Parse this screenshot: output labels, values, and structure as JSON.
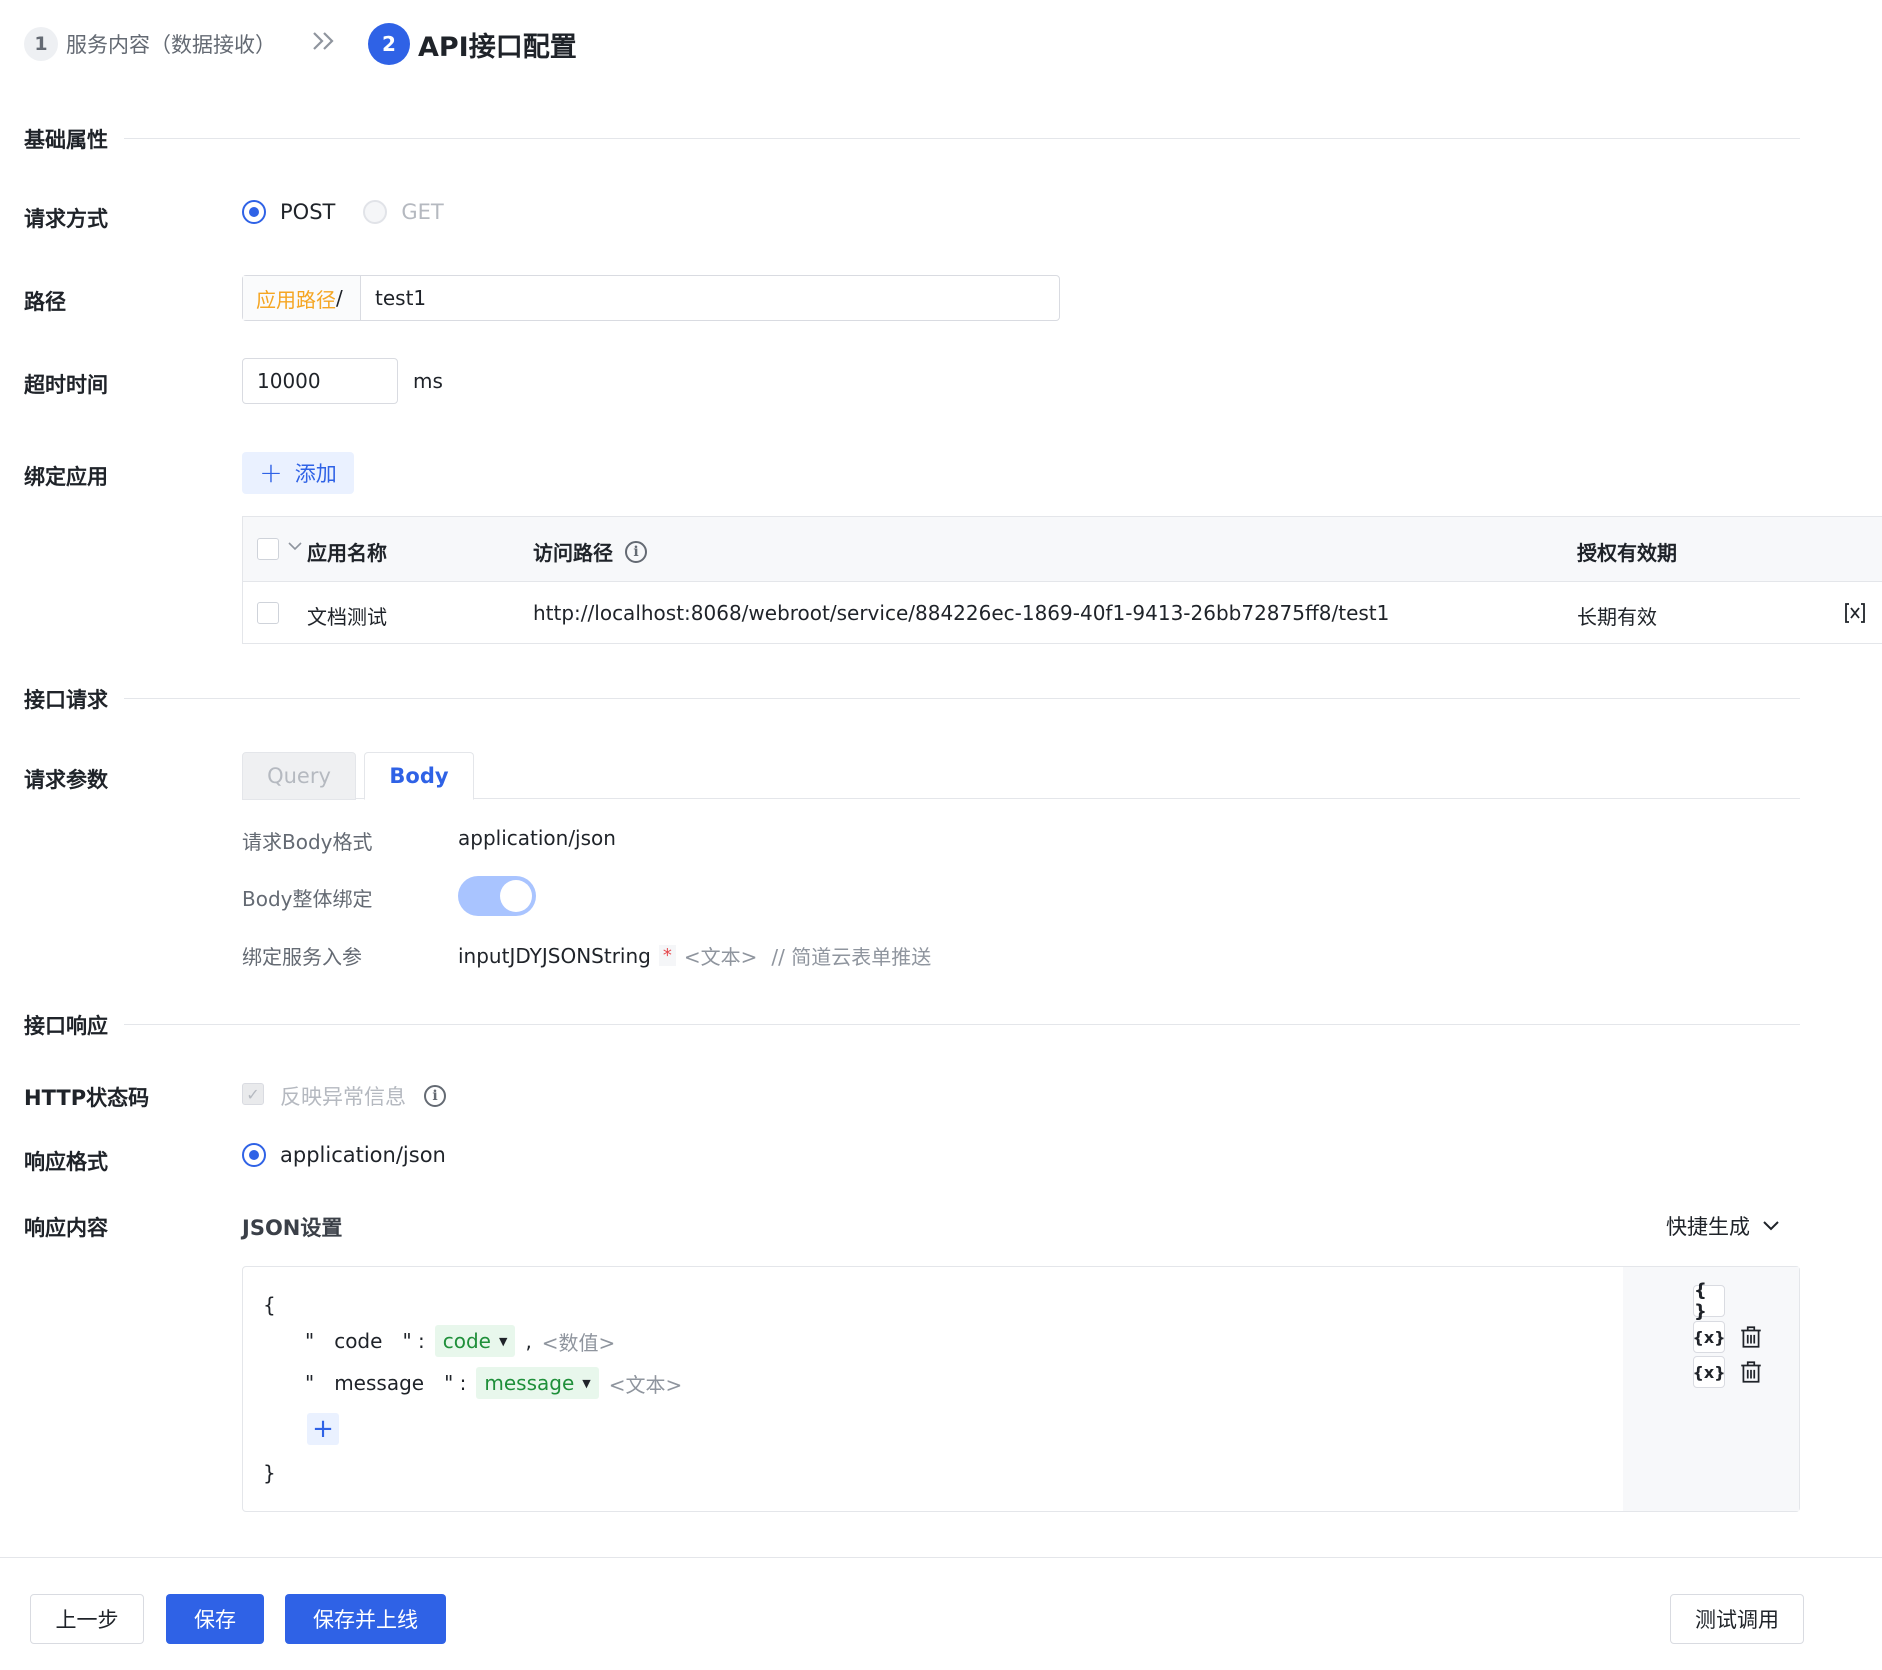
{
  "steps": [
    {
      "num": "1",
      "label": "服务内容（数据接收）"
    },
    {
      "num": "2",
      "label": "API接口配置"
    }
  ],
  "sections": {
    "basic": "基础属性",
    "request": "接口请求",
    "response": "接口响应"
  },
  "basic": {
    "method_label": "请求方式",
    "method_options": [
      "POST",
      "GET"
    ],
    "method_selected": "POST",
    "path_label": "路径",
    "path_prefix": "应用路径",
    "path_slash": "/",
    "path_value": "test1",
    "timeout_label": "超时时间",
    "timeout_value": "10000",
    "timeout_unit": "ms",
    "bind_label": "绑定应用",
    "add_label": "添加"
  },
  "bind_table": {
    "headers": [
      "应用名称",
      "访问路径",
      "授权有效期"
    ],
    "rows": [
      {
        "name": "文档测试",
        "path": "http://localhost:8068/webroot/service/884226ec-1869-40f1-9413-26bb72875ff8/test1",
        "validity": "长期有效"
      }
    ]
  },
  "request": {
    "params_label": "请求参数",
    "tabs": [
      "Query",
      "Body"
    ],
    "active_tab": "Body",
    "body_format_label": "请求Body格式",
    "body_format_value": "application/json",
    "body_bind_label": "Body整体绑定",
    "body_bind_on": true,
    "service_param_label": "绑定服务入参",
    "service_param_name": "inputJDYJSONString",
    "service_param_required": "*",
    "service_param_type": "<文本>",
    "service_param_comment": "// 简道云表单推送"
  },
  "response": {
    "http_label": "HTTP状态码",
    "http_check_label": "反映异常信息",
    "format_label": "响应格式",
    "format_value": "application/json",
    "content_label": "响应内容",
    "json_title": "JSON设置",
    "quick_gen": "快捷生成",
    "json_open": "{",
    "json_close": "}",
    "fields": [
      {
        "key": "code",
        "value": "code",
        "type": "<数值>"
      },
      {
        "key": "message",
        "value": "message",
        "type": "<文本>"
      }
    ]
  },
  "footer": {
    "prev": "上一步",
    "save": "保存",
    "save_online": "保存并上线",
    "test": "测试调用"
  },
  "colors": {
    "primary": "#2f62e6",
    "prefix": "#f5a623",
    "tag_green": "#1f8f3a",
    "required": "#e5484d"
  }
}
